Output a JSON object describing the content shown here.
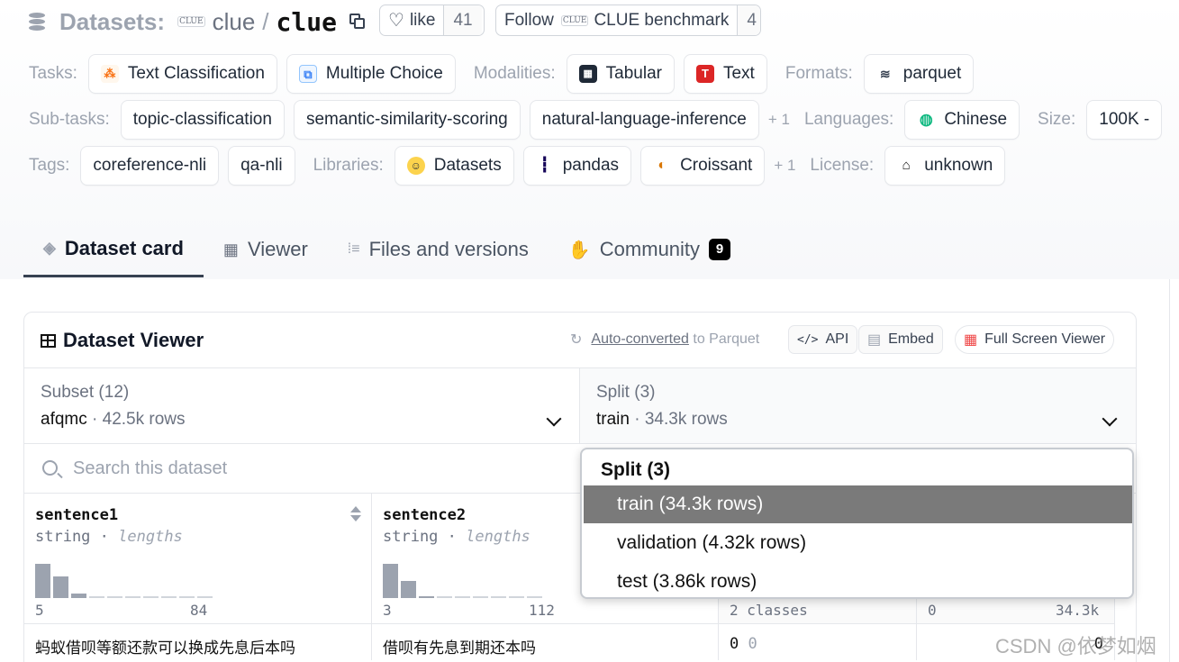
{
  "header": {
    "label": "Datasets:",
    "org": "clue",
    "sep": "/",
    "name": "clue",
    "org_icon_text": "CLUE",
    "like_label": "like",
    "like_count": "41",
    "follow_label": "Follow",
    "follow_org": "CLUE benchmark",
    "follow_count": "4"
  },
  "meta": {
    "tasks_label": "Tasks:",
    "tasks": [
      "Text Classification",
      "Multiple Choice"
    ],
    "modalities_label": "Modalities:",
    "modalities": [
      "Tabular",
      "Text"
    ],
    "formats_label": "Formats:",
    "formats": [
      "parquet"
    ],
    "subtasks_label": "Sub-tasks:",
    "subtasks": [
      "topic-classification",
      "semantic-similarity-scoring",
      "natural-language-inference"
    ],
    "subtasks_more": "+ 1",
    "languages_label": "Languages:",
    "languages": [
      "Chinese"
    ],
    "size_label": "Size:",
    "size": "100K -",
    "tags_label": "Tags:",
    "tags": [
      "coreference-nli",
      "qa-nli"
    ],
    "libraries_label": "Libraries:",
    "libraries": [
      "Datasets",
      "pandas",
      "Croissant"
    ],
    "libraries_more": "+ 1",
    "license_label": "License:",
    "license": "unknown"
  },
  "tabs": [
    {
      "label": "Dataset card",
      "icon": "cube-icon"
    },
    {
      "label": "Viewer",
      "icon": "table-icon"
    },
    {
      "label": "Files and versions",
      "icon": "files-icon"
    },
    {
      "label": "Community",
      "icon": "community-icon",
      "badge": "9"
    }
  ],
  "viewer": {
    "title": "Dataset Viewer",
    "auto_link": "Auto-converted",
    "auto_rest": "to Parquet",
    "api": "API",
    "embed": "Embed",
    "fullscreen": "Full Screen Viewer",
    "subset_label": "Subset (12)",
    "subset_value": "afqmc",
    "subset_rows": "· 42.5k rows",
    "split_label": "Split (3)",
    "split_value": "train",
    "split_rows": "· 34.3k rows",
    "search_placeholder": "Search this dataset",
    "columns": [
      {
        "name": "sentence1",
        "type": "string",
        "stat": "lengths",
        "min": "5",
        "max": "84",
        "hist": [
          1.0,
          0.62,
          0.12,
          0,
          0,
          0,
          0,
          0,
          0,
          0
        ]
      },
      {
        "name": "sentence2",
        "type": "string",
        "stat": "lengths",
        "min": "3",
        "max": "112",
        "hist": [
          1.0,
          0.5,
          0.05,
          0,
          0,
          0,
          0,
          0,
          0
        ]
      }
    ],
    "label_col": {
      "type": "2 classes"
    },
    "idx_col": {
      "min": "0",
      "max": "34.3k"
    },
    "row1": {
      "sentence1": "蚂蚁借呗等额还款可以换成先息后本吗",
      "sentence2": "借呗有先息到期还本吗",
      "label": "0",
      "label_name": "0",
      "idx": "0"
    }
  },
  "split_dropdown": {
    "title": "Split (3)",
    "options": [
      "train (34.3k rows)",
      "validation (4.32k rows)",
      "test (3.86k rows)"
    ],
    "highlighted": "train (34.3k rows)"
  },
  "watermark": "CSDN @依梦如烟",
  "colors": {
    "accent": "#111827",
    "muted": "#9ca3af",
    "highlight": "#7a7a7a",
    "tabular": "#1f2937",
    "text_red": "#dc2626"
  }
}
